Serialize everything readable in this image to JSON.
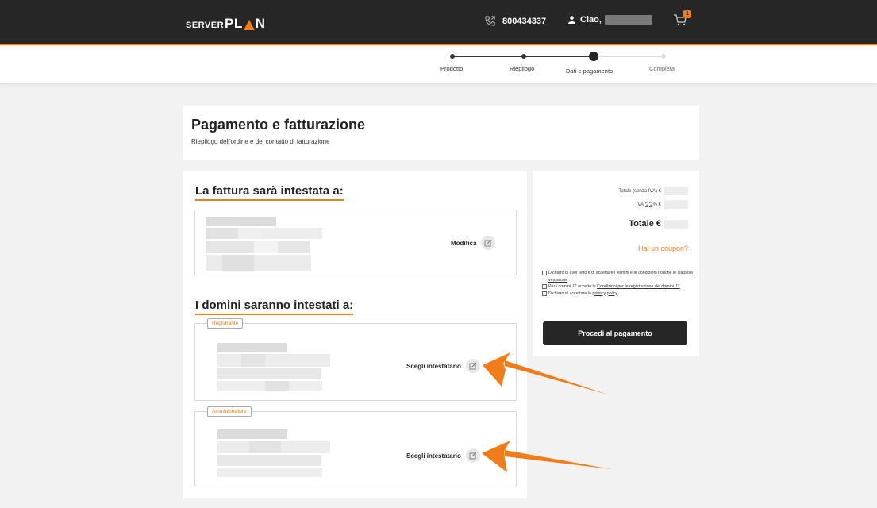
{
  "header": {
    "logo_small": "SERVER",
    "logo_big_1": "PL",
    "logo_big_2": "N",
    "phone": "800434337",
    "greeting": "Ciao,",
    "cart_count": "1"
  },
  "stepper": {
    "steps": [
      {
        "label": "Prodotto",
        "state": "done"
      },
      {
        "label": "Riepilogo",
        "state": "done"
      },
      {
        "label": "Dati e pagamento",
        "state": "current"
      },
      {
        "label": "Completa",
        "state": "todo"
      }
    ]
  },
  "page": {
    "title": "Pagamento e fatturazione",
    "subtitle": "Riepilogo dell'ordine e del contatto di fatturazione"
  },
  "invoice": {
    "heading": "La fattura sarà intestata a:",
    "edit_label": "Modifica"
  },
  "domains": {
    "heading": "I domini saranno intestati a:",
    "registrant_tag": "Registrante",
    "admin_tag": "Amministratore",
    "choose_label": "Scegli intestatario"
  },
  "summary": {
    "subtotal_label": "Totale (senza IVA) €",
    "vat_prefix": "IVA",
    "vat_rate": "22",
    "vat_suffix": "% €",
    "total_label": "Totale €",
    "coupon_link": "Hai un coupon?",
    "terms_1a": "Dichiaro di aver letto e di accettare i",
    "terms_1b": "termini e le condizioni",
    "terms_1c": "nonché le",
    "terms_1d": "clausole vessatorie",
    "terms_2a": "Per i domini .IT accetto le",
    "terms_2b": "Condizioni per la registrazione dei domini .IT",
    "terms_3a": "Dichiaro di accettare la",
    "terms_3b": "privacy policy",
    "pay_button": "Procedi al pagamento"
  },
  "colors": {
    "accent": "#f07d1a",
    "dark": "#262626",
    "background": "#f2f2f2"
  }
}
